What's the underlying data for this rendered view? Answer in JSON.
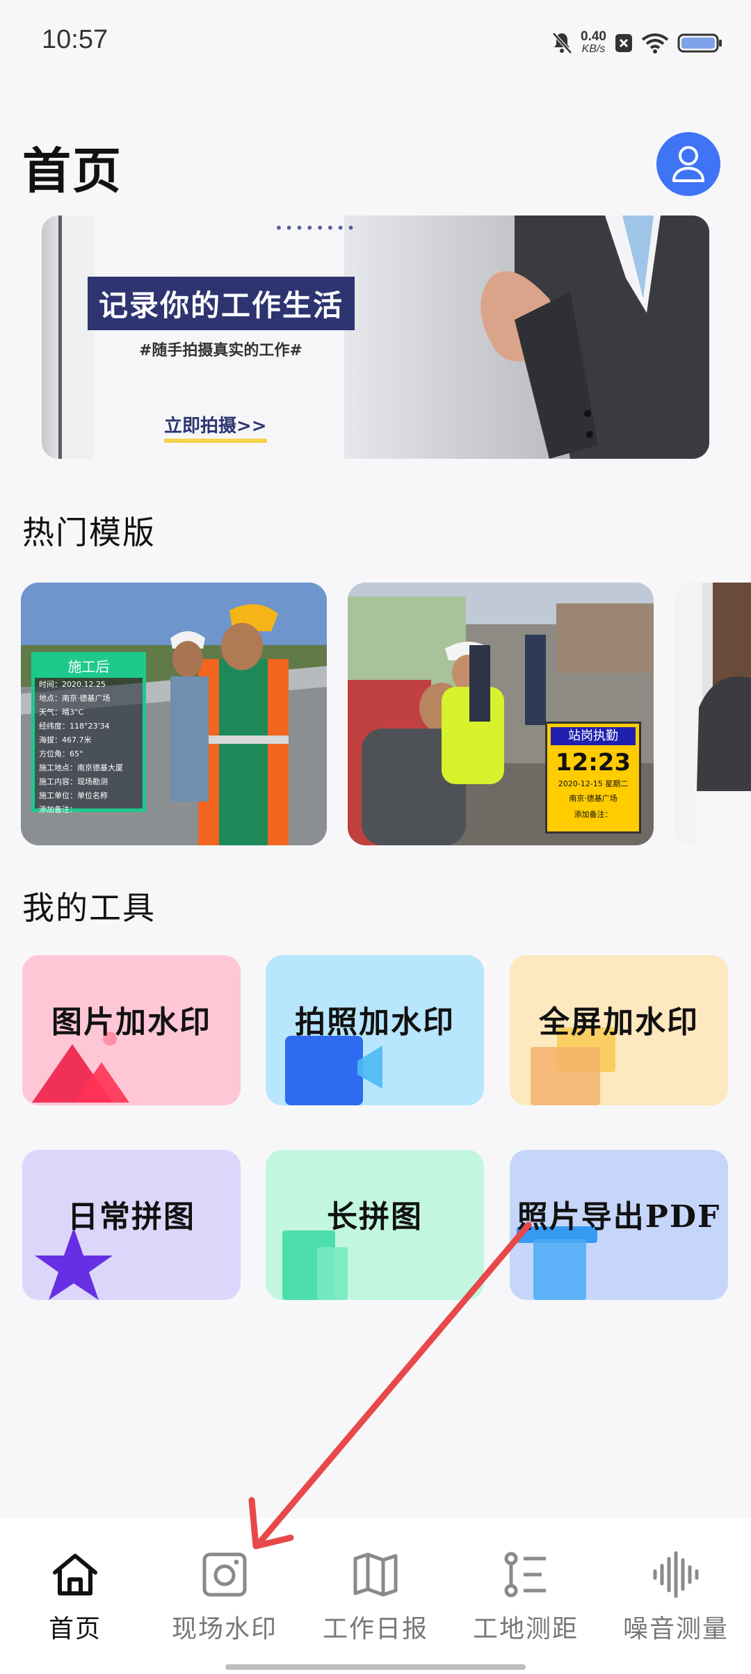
{
  "status_bar": {
    "time": "10:57",
    "net_speed_value": "0.40",
    "net_speed_unit": "KB/s",
    "icons": [
      "mute-bell-icon",
      "close-box-icon",
      "wifi-icon",
      "battery-icon"
    ]
  },
  "header": {
    "title": "首页",
    "avatar_icon": "user-icon"
  },
  "banner": {
    "headline": "记录你的工作生活",
    "subtitle": "#随手拍摄真实的工作#",
    "cta": "立即拍摄>>"
  },
  "sections": {
    "templates_title": "热门模版",
    "tools_title": "我的工具"
  },
  "templates": [
    {
      "overlay_title": "施工后",
      "rows": [
        "时间：2020.12.25",
        "地点：南京·德基广场",
        "天气：晴3°C",
        "经纬度：118°23'34",
        "海拔：467.7米",
        "方位角：65°",
        "施工地点：南京德基大厦",
        "施工内容：现场勘测",
        "施工单位：单位名称",
        "添加备注："
      ]
    },
    {
      "overlay_title": "站岗执勤",
      "time": "12:23",
      "date": "2020-12-15 星期二",
      "location": "南京·德基广场",
      "note": "添加备注："
    },
    {}
  ],
  "tools": [
    {
      "label": "图片加水印",
      "color": "#ffc7d6",
      "icon": "mountain-icon"
    },
    {
      "label": "拍照加水印",
      "color": "#b8e6fc",
      "icon": "video-camera-icon"
    },
    {
      "label": "全屏加水印",
      "color": "#fde8bf",
      "icon": "fullscreen-icon"
    },
    {
      "label": "日常拼图",
      "color": "#dcd6fb",
      "icon": "star-icon"
    },
    {
      "label": "长拼图",
      "color": "#c3f6df",
      "icon": "long-image-icon"
    },
    {
      "label": "照片导出PDF",
      "color": "#c6d6fa",
      "icon": "pdf-export-icon"
    }
  ],
  "bottom_nav": [
    {
      "label": "首页",
      "icon": "home-icon",
      "active": true
    },
    {
      "label": "现场水印",
      "icon": "camera-icon",
      "active": false
    },
    {
      "label": "工作日报",
      "icon": "map-book-icon",
      "active": false
    },
    {
      "label": "工地测距",
      "icon": "ruler-list-icon",
      "active": false
    },
    {
      "label": "噪音测量",
      "icon": "sound-wave-icon",
      "active": false
    }
  ],
  "colors": {
    "accent": "#3f74f5",
    "annotation_arrow": "#e8484a"
  }
}
